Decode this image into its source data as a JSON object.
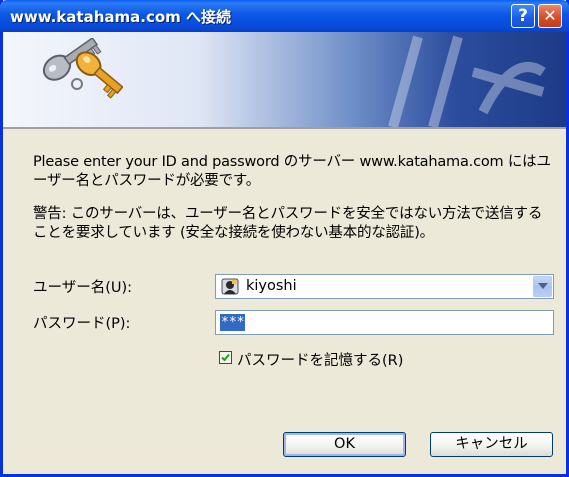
{
  "window": {
    "title": "www.katahama.com へ接続",
    "help_label": "?",
    "close_label": "✕"
  },
  "message": {
    "line1": "Please enter your ID and password のサーバー www.katahama.com にはユーザー名とパスワードが必要です。",
    "warning": "警告: このサーバーは、ユーザー名とパスワードを安全ではない方法で送信することを要求しています (安全な接続を使わない基本的な認証)。"
  },
  "form": {
    "username_label": "ユーザー名(U):",
    "username_value": "kiyoshi",
    "password_label": "パスワード(P):",
    "password_value": "***",
    "remember_label": "パスワードを記憶する(R)",
    "remember_checked": true
  },
  "buttons": {
    "ok": "OK",
    "cancel": "キャンセル"
  },
  "colors": {
    "titlebar": "#0a53e3",
    "dialog_bg": "#ece9d8",
    "selection": "#316ac5"
  },
  "icons": [
    "keys-icon",
    "user-account-icon",
    "dropdown-arrow-icon",
    "checkmark-icon"
  ]
}
